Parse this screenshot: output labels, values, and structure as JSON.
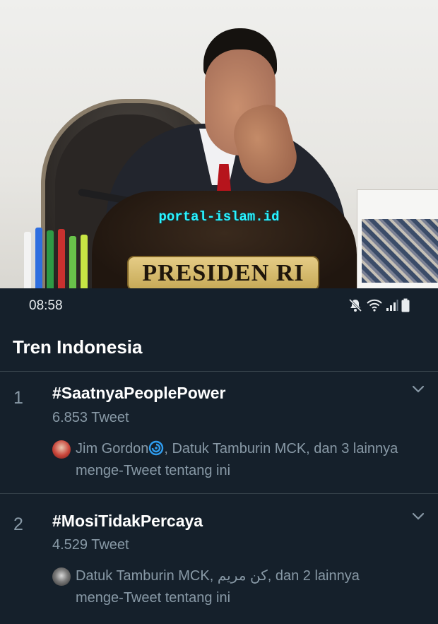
{
  "photo": {
    "watermark": "portal-islam.id",
    "podium_text": "PRESIDEN RI"
  },
  "status_bar": {
    "time": "08:58",
    "icons": [
      "mute-icon",
      "wifi-icon",
      "signal-icon",
      "battery-icon"
    ]
  },
  "header": {
    "title": "Tren Indonesia"
  },
  "trends": [
    {
      "rank": "1",
      "hashtag": "#SaatnyaPeoplePower",
      "count": "6.853 Tweet",
      "context_name": "Jim Gordon",
      "context_rest": ", Datuk Tamburin MCK, dan 3 lainnya menge-Tweet tentang ini"
    },
    {
      "rank": "2",
      "hashtag": "#MosiTidakPercaya",
      "count": "4.529 Tweet",
      "context_name": "Datuk Tamburin MCK, كن مريم",
      "context_rest": ", dan 2 lainnya menge-Tweet tentang ini"
    }
  ],
  "colors": {
    "background": "#15202b",
    "divider": "#38444d",
    "secondary_text": "#8899a6",
    "watermark": "#2af5ff"
  }
}
